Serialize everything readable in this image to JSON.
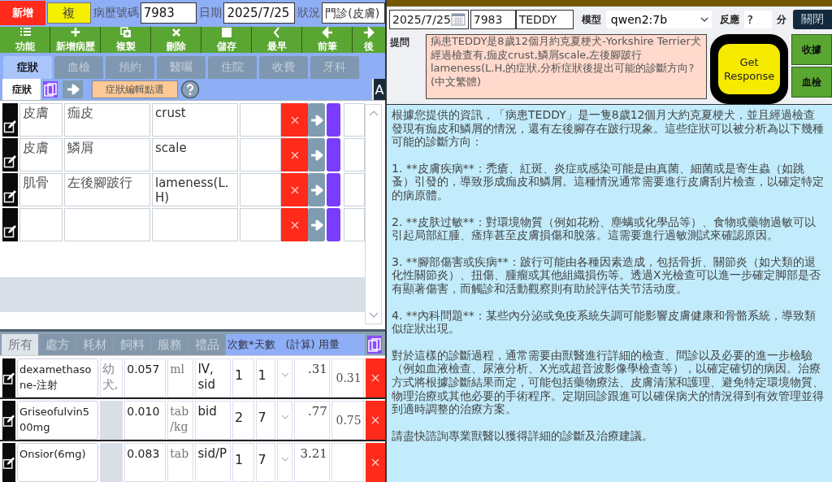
{
  "record_bar": {
    "new_button": "新增",
    "copy_button": "複",
    "fields": [
      {
        "label": "病歷號碼",
        "value": "7983"
      },
      {
        "label": "日期",
        "value": "2025/7/25"
      },
      {
        "label": "狀況",
        "value": "門診(皮膚)"
      }
    ]
  },
  "toolbar": [
    {
      "label": "功能"
    },
    {
      "label": "新增病歷"
    },
    {
      "label": "複製"
    },
    {
      "label": "刪除"
    },
    {
      "label": "儲存"
    },
    {
      "label": "最早"
    },
    {
      "label": "前筆"
    },
    {
      "label": "後"
    }
  ],
  "main_tabs": [
    {
      "label": "症狀",
      "selected": true
    },
    {
      "label": "血檢",
      "selected": false
    },
    {
      "label": "預約",
      "selected": false
    },
    {
      "label": "醫囑",
      "selected": false
    },
    {
      "label": "住院",
      "selected": false
    },
    {
      "label": "收費",
      "selected": false
    },
    {
      "label": "牙科",
      "selected": false
    }
  ],
  "sub_toolbar": {
    "tab": "症狀",
    "edit_button": "症狀編輯點選",
    "side_button": "A"
  },
  "symptoms": [
    {
      "kind": "entry",
      "category": "皮膚",
      "name": "痂皮",
      "english": "crust"
    },
    {
      "kind": "entry",
      "category": "皮膚",
      "name": "鱗屑",
      "english": "scale"
    },
    {
      "kind": "entry",
      "category": "肌骨",
      "name": "左後腳跛行",
      "english": "lameness(L.H)"
    },
    {
      "kind": "blank"
    }
  ],
  "order_tabs": [
    {
      "label": "所有",
      "selected": true
    },
    {
      "label": "處方",
      "selected": false
    },
    {
      "label": "耗材",
      "selected": false
    },
    {
      "label": "飼料",
      "selected": false
    },
    {
      "label": "服務",
      "selected": false
    },
    {
      "label": "禮品",
      "selected": false
    }
  ],
  "order_header": "次數*天數　(計算) 用量",
  "orders": [
    {
      "name": "dexamethasone-注射",
      "note": "幼犬,",
      "dose": "0.057",
      "unit": "ml",
      "route": "IV, sid",
      "times": "1",
      "days": "1",
      "calc": ".31",
      "qty": "0.31"
    },
    {
      "name": "Griseofulvin500mg",
      "dose": "0.010",
      "unit": "tab/kg",
      "route": "bid",
      "times": "2",
      "days": "7",
      "calc": ".77",
      "qty": "0.75"
    },
    {
      "name": "Onsior(6mg)",
      "dose": "0.083",
      "unit": "tab",
      "route": "sid/P",
      "times": "1",
      "days": "7",
      "calc": "3.21"
    }
  ],
  "query": {
    "date": "2025/7/25",
    "record_no": "7983",
    "patient": "TEDDY",
    "model_label": "模型",
    "model": "qwen2:7b",
    "response_label": "反應",
    "response_time": "?",
    "unit": "分",
    "close_button": "關閉"
  },
  "prompt": {
    "label": "提問",
    "text": "病患TEDDY是8歲12個月約克夏梗犬-Yorkshire Terrier犬經過檢查有,痂皮crust,鱗屑scale,左後腳跛行lameness(L.H,的症狀,分析症狀後提出可能的診斷方向?(中文繁體)"
  },
  "get_response_button": "Get Response",
  "side_buttons": [
    "收據",
    "血檢"
  ],
  "response": [
    "根據您提供的資訊，「病患TEDDY」是一隻8歲12個月大約克夏梗犬，並且經過檢查發現有痂皮和鱗屑的情況，還有左後腳存在跛行現象。這些症狀可以被分析為以下幾種可能的診斷方向：",
    "1. **皮膚疾病**：禿瘡、紅斑、炎症或感染可能是由真菌、細菌或是寄生蟲（如跳蚤）引發的，導致形成痂皮和鱗屑。這種情況通常需要進行皮膚刮片檢查，以確定特定的病原體。",
    "2. **皮肤过敏**：對環境物質（例如花粉、塵螨或化學品等）、食物或藥物過敏可以引起局部紅腫、瘙痒甚至皮膚損傷和脫落。這需要進行過敏測試來確認原因。",
    "3. **腳部傷害或疾病**：跛行可能由各種因素造成，包括骨折、關節炎（如犬類的退化性關節炎）、扭傷、腫瘤或其他組織損伤等。透過X光檢查可以進一步確定脚部是否有顯著傷害，而觸診和活動觀察則有助於評估关节活动度。",
    "4. **內科問題**：某些內分泌或免疫系統失調可能影響皮膚健康和骨骼系統，導致類似症狀出現。",
    "對於這樣的診斷過程，通常需要由獸醫進行詳細的檢查、問診以及必要的進一步檢驗（例如血液檢查、尿液分析、X光或超音波影像學檢查等），以確定確切的病因。治療方式將根據診斷結果而定，可能包括藥物療法、皮膚清潔和護理、避免特定環境物質、物理治療或其他必要的手術程序。定期回診跟進可以確保病犬的情況得到有效管理並得到適時調整的治療方案。",
    "請盡快諮詢專業獸醫以獲得詳細的診斷及治療建議。"
  ]
}
